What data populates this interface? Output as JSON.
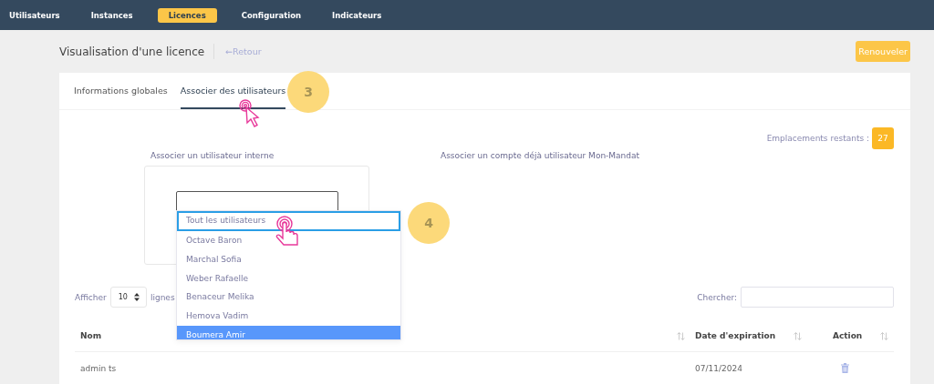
{
  "nav": {
    "items": [
      {
        "label": "Utilisateurs",
        "selected": false
      },
      {
        "label": "Instances",
        "selected": false
      },
      {
        "label": "Licences",
        "selected": true
      },
      {
        "label": "Configuration",
        "selected": false
      },
      {
        "label": "Indicateurs",
        "selected": false
      }
    ]
  },
  "header": {
    "title": "Visualisation d'une licence",
    "back_link": "←Retour",
    "renew_button": "Renouveler"
  },
  "tabs": [
    {
      "label": "Informations globales",
      "selected": false
    },
    {
      "label": "Associer des utilisateurs",
      "selected": true
    }
  ],
  "slots": {
    "label": "Emplacements restants :",
    "count": "27"
  },
  "internal_user": {
    "label": "Associer un utilisateur interne",
    "dropdown": {
      "options": [
        {
          "label": "Tout les utilisateurs",
          "focused": true,
          "selected": false
        },
        {
          "label": "Octave Baron",
          "focused": false,
          "selected": false
        },
        {
          "label": "Marchal Sofia",
          "focused": false,
          "selected": false
        },
        {
          "label": "Weber Rafaelle",
          "focused": false,
          "selected": false
        },
        {
          "label": "Benaceur Melika",
          "focused": false,
          "selected": false
        },
        {
          "label": "Hemova Vadim",
          "focused": false,
          "selected": false
        },
        {
          "label": "Boumera Amir",
          "focused": false,
          "selected": true
        }
      ]
    }
  },
  "existing_account": {
    "label": "Associer un compte déjà utilisateur Mon-Mandat"
  },
  "table_controls": {
    "show_label": "Afficher",
    "page_size": "10",
    "rows_label": "lignes",
    "search_label": "Chercher:"
  },
  "table": {
    "columns": [
      "Nom",
      "Date d'expiration",
      "Action"
    ],
    "rows": [
      {
        "name": "admin ts",
        "expiration": "07/11/2024"
      }
    ]
  },
  "annotations": [
    {
      "label": "3",
      "kind": "tap"
    },
    {
      "label": "4",
      "kind": "touch"
    }
  ]
}
